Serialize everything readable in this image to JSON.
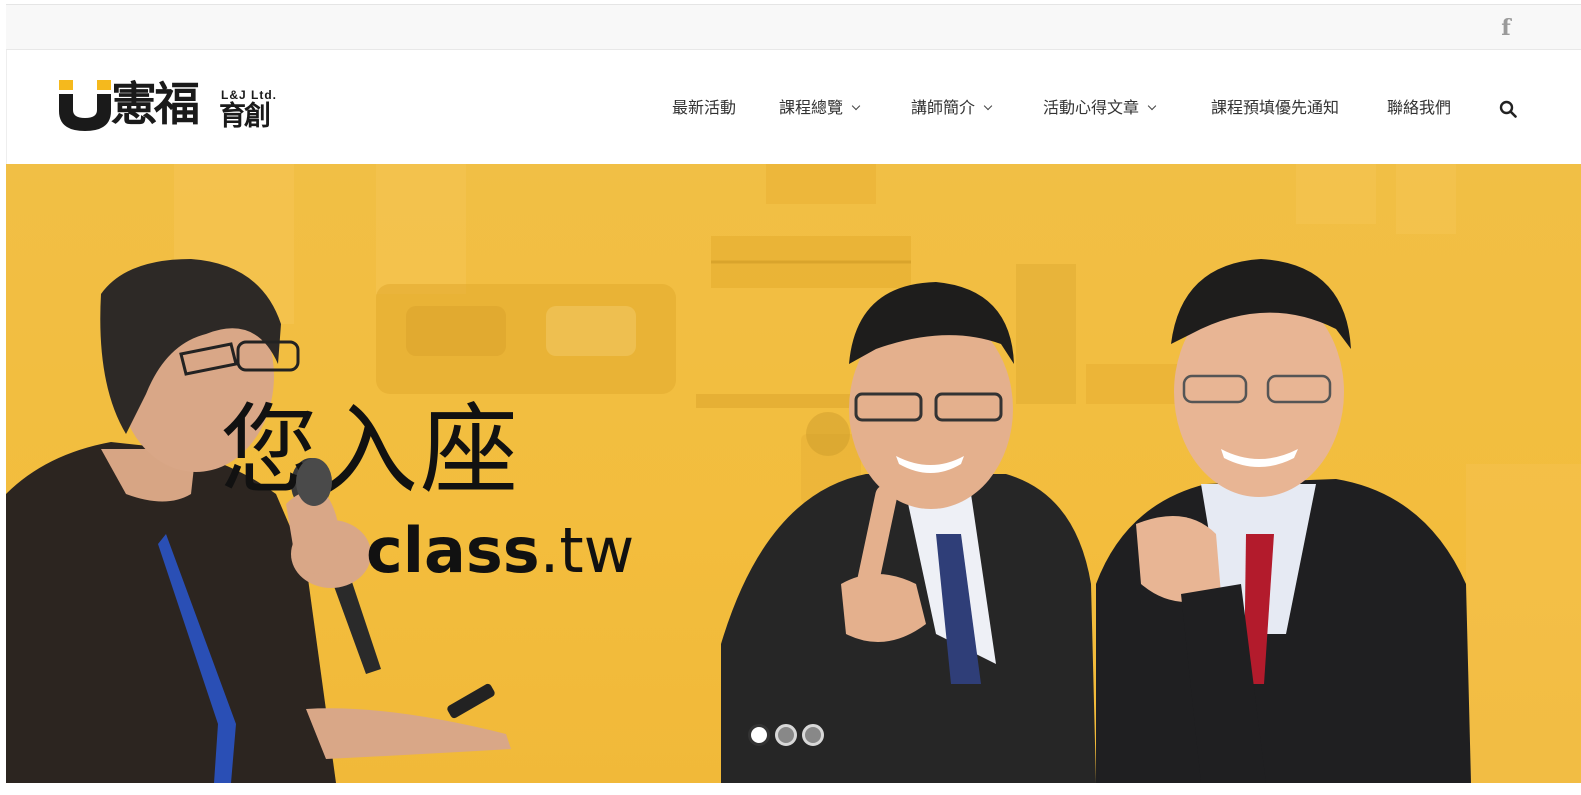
{
  "topbar": {
    "social_icon": "facebook-icon"
  },
  "header": {
    "logo": {
      "main": "憲福",
      "en": "L&J Ltd.",
      "sub": "育創"
    },
    "nav": [
      {
        "label": "最新活動",
        "has_dropdown": false
      },
      {
        "label": "課程總覽",
        "has_dropdown": true
      },
      {
        "label": "講師簡介",
        "has_dropdown": true
      },
      {
        "label": "活動心得文章",
        "has_dropdown": true
      },
      {
        "label": "課程預填優先通知",
        "has_dropdown": false
      },
      {
        "label": "聯絡我們",
        "has_dropdown": false
      }
    ],
    "search_icon": "search-icon"
  },
  "hero": {
    "headline": "您入座",
    "domain_bold": "class",
    "domain_rest": ".tw",
    "slides_total": 3,
    "active_slide": 1
  },
  "colors": {
    "brand_yellow": "#f5b91d",
    "hero_background": "#f2bd41",
    "text_dark": "#333333",
    "icon_gray": "#9a9a9a"
  }
}
